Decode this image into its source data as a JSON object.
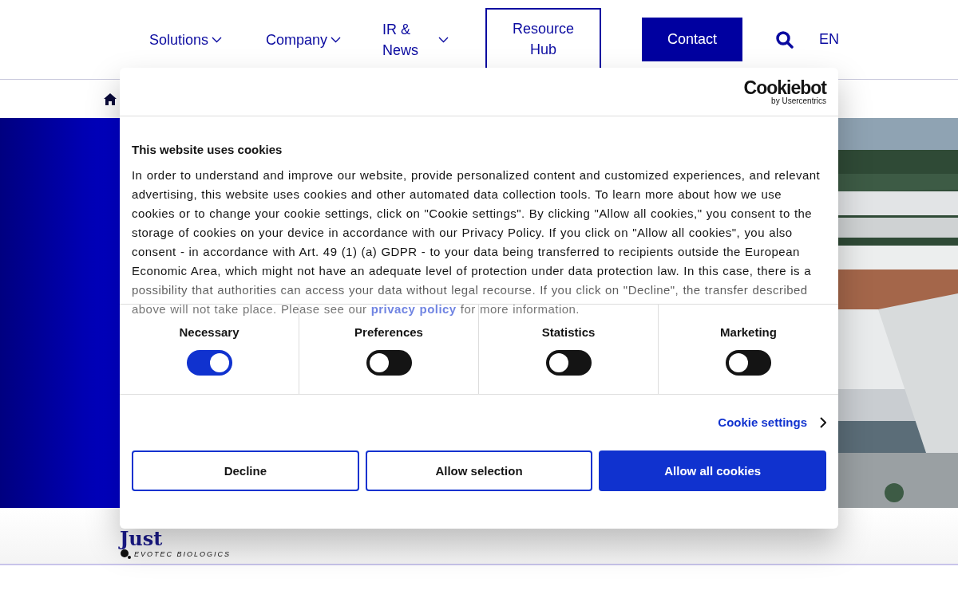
{
  "nav": {
    "items": [
      {
        "label": "Solutions",
        "kind": "dropdown"
      },
      {
        "label": "Company",
        "kind": "dropdown"
      },
      {
        "label": "IR & News",
        "kind": "dropdown"
      },
      {
        "label": "Resource Hub",
        "kind": "outlined"
      },
      {
        "label": "Contact",
        "kind": "filled"
      }
    ],
    "language": "EN"
  },
  "footer_logo": {
    "wordmark": "Just",
    "tagline": "EVOTEC BIOLOGICS"
  },
  "cookie_dialog": {
    "brand": "Cookiebot",
    "brand_sub": "by Usercentrics",
    "title": "This website uses cookies",
    "text_before": "In order to understand and improve our website, provide personalized content and customized experiences, and relevant advertising, this website uses cookies and other automated data collection tools. To learn more about how we use cookies or to change your cookie settings, click on \"Cookie settings\". By clicking \"Allow all cookies,\" you consent to the storage of cookies on your device in accordance with our Privacy Policy. If you click on \"Allow all cookies\", you also consent - in accordance with Art. 49 (1) (a) GDPR - to your data being transferred to recipients outside the European Economic Area, which might not have an adequate level of protection under data protection law. In this case, there is a possibility that authorities can access your data without legal recourse. If you click on \"Decline\", the transfer described above will not take place. Please see our",
    "link": "privacy policy",
    "text_after": "for more information.",
    "categories": [
      {
        "label": "Necessary",
        "on": true
      },
      {
        "label": "Preferences",
        "on": false
      },
      {
        "label": "Statistics",
        "on": false
      },
      {
        "label": "Marketing",
        "on": false
      }
    ],
    "settings_link": "Cookie settings",
    "buttons": [
      {
        "label": "Decline",
        "kind": "outline"
      },
      {
        "label": "Allow selection",
        "kind": "outline"
      },
      {
        "label": "Allow all cookies",
        "kind": "primary"
      }
    ]
  }
}
